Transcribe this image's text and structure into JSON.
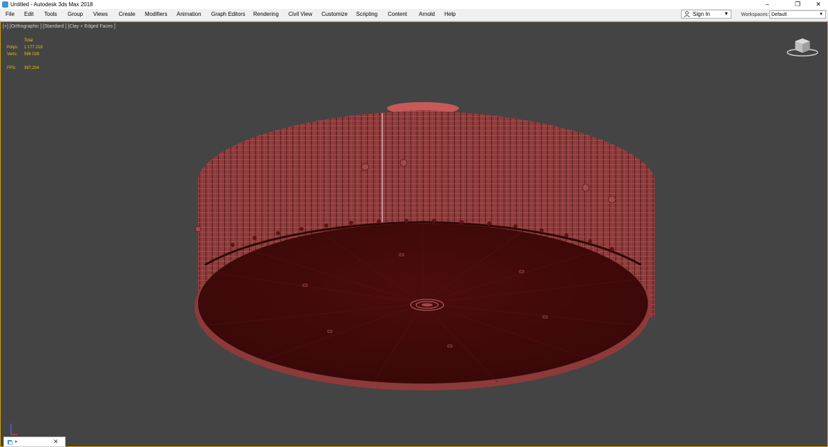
{
  "window": {
    "title": "Untitled - Autodesk 3ds Max 2018",
    "minimize": "–",
    "restore": "❐",
    "close": "✕",
    "icon": "3ds-max-app-icon"
  },
  "menu": {
    "items": [
      "File",
      "Edit",
      "Tools",
      "Group",
      "Views",
      "Create",
      "Modifiers",
      "Animation",
      "Graph Editors",
      "Rendering",
      "Civil View",
      "Customize",
      "Scripting",
      "Content",
      "Arnold",
      "Help"
    ]
  },
  "account": {
    "signin_label": "Sign In",
    "signin_icon": "user-icon",
    "dropdown_icon": "caret-down-icon"
  },
  "workspace": {
    "label": "Workspaces:",
    "value": "Default",
    "dropdown_icon": "caret-down-icon"
  },
  "viewport": {
    "label": "[+] [Orthographic ] [Standard ] [Clay + Edged Faces ]",
    "stats": {
      "total_label": "Total",
      "polys_label": "Polys:",
      "polys_value": "1 177 218",
      "verts_label": "Verts:",
      "verts_value": "596 028",
      "fps_label": "FPS:",
      "fps_value": "397,204"
    },
    "border_color": "#d6a400",
    "background_color": "#444444",
    "model_color": "#8a2a2a",
    "navigation": "viewcube"
  },
  "mini_panel": {
    "icon": "layer-icon",
    "arrow": "▸",
    "close": "✕"
  }
}
